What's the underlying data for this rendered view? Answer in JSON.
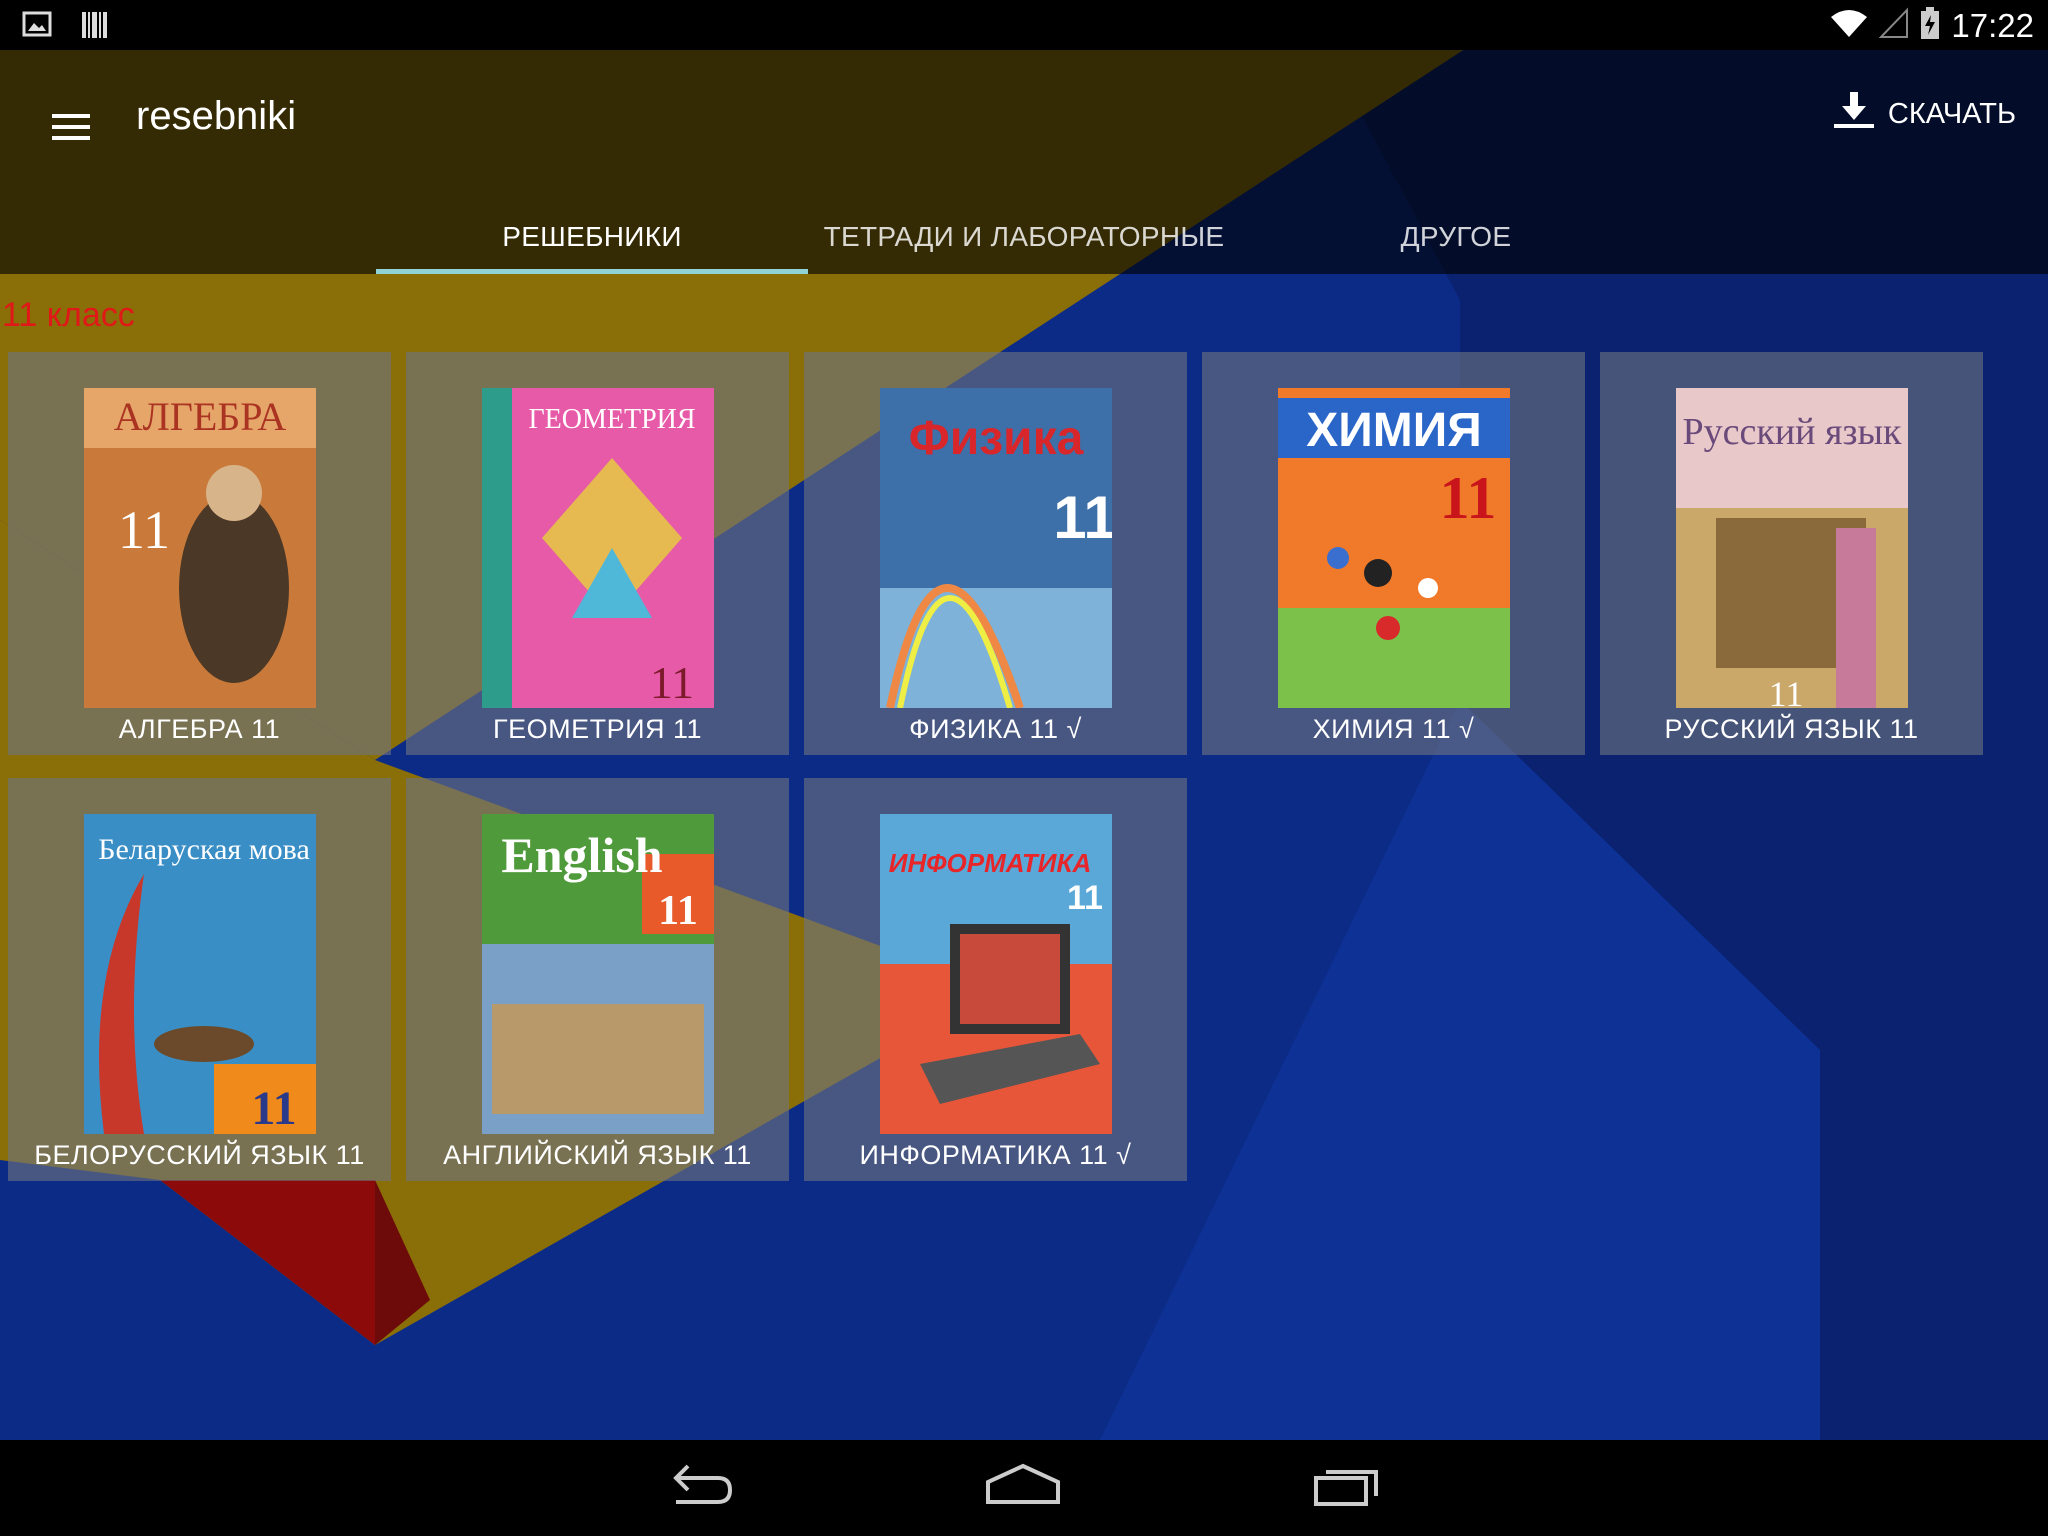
{
  "status_bar": {
    "left_icons": [
      "image-notification-icon",
      "barcode-notification-icon"
    ],
    "right_icons": [
      "wifi-icon",
      "cellular-signal-icon",
      "battery-charging-icon"
    ],
    "time": "17:22"
  },
  "app_bar": {
    "menu_icon": "hamburger-menu-icon",
    "title": "resebniki",
    "download_icon": "download-icon",
    "download_label": "СКАЧАТЬ"
  },
  "tabs": [
    {
      "label": "РЕШЕБНИКИ",
      "active": true
    },
    {
      "label": "ТЕТРАДИ И ЛАБОРАТОРНЫЕ",
      "active": false
    },
    {
      "label": "ДРУГОЕ",
      "active": false
    }
  ],
  "section_title": "11 класс",
  "books": [
    {
      "label": "АЛГЕБРА 11",
      "cover_title": "АЛГЕБРА",
      "cover_number": "11",
      "cover_color": "#c97a3a"
    },
    {
      "label": "ГЕОМЕТРИЯ 11",
      "cover_title": "ГЕОМЕТРИЯ",
      "cover_number": "11",
      "cover_color": "#e75aa8"
    },
    {
      "label": "ФИЗИКА 11  √",
      "cover_title": "Физика",
      "cover_number": "11",
      "cover_color": "#3d6fa8"
    },
    {
      "label": "ХИМИЯ 11  √",
      "cover_title": "ХИМИЯ",
      "cover_number": "11",
      "cover_color": "#f07a2a"
    },
    {
      "label": "РУССКИЙ ЯЗЫК 11",
      "cover_title": "Русский язык",
      "cover_number": "11",
      "cover_color": "#c9a86a"
    },
    {
      "label": "БЕЛОРУССКИЙ ЯЗЫК 11",
      "cover_title": "Беларуская мова",
      "cover_number": "11",
      "cover_color": "#3a8ec6"
    },
    {
      "label": "АНГЛИЙСКИЙ ЯЗЫК 11",
      "cover_title": "English",
      "cover_number": "11",
      "cover_color": "#4f9a3a"
    },
    {
      "label": "ИНФОРМАТИКА 11  √",
      "cover_title": "ИНФОРМАТИКА",
      "cover_number": "11",
      "cover_color": "#e8563a"
    }
  ],
  "nav_bar": [
    "back-icon",
    "home-icon",
    "recent-apps-icon"
  ]
}
